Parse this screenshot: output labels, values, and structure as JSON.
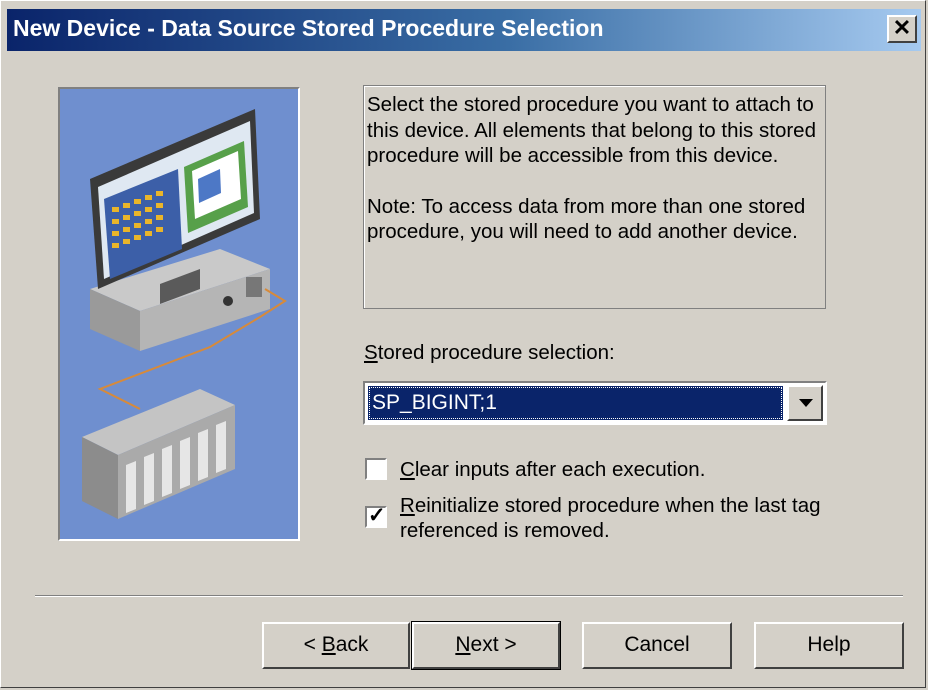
{
  "window": {
    "title": "New Device - Data Source Stored Procedure Selection",
    "close_label": "✕"
  },
  "description": {
    "paragraph1": "Select the stored procedure you want to attach to this device.  All elements that belong to this stored procedure will be accessible from this device.",
    "paragraph2": "Note: To access data from more than one stored procedure, you will need to add another device."
  },
  "selection": {
    "label_prefix": "",
    "label_accel": "S",
    "label_rest": "tored procedure selection:",
    "value": "SP_BIGINT;1"
  },
  "options": {
    "clear_inputs": {
      "accel": "C",
      "rest": "lear inputs after each execution.",
      "checked": false
    },
    "reinitialize": {
      "accel": "R",
      "line1_rest": "einitialize stored procedure when the last tag",
      "line2": "referenced is removed.",
      "checked": true
    }
  },
  "buttons": {
    "back": {
      "prefix": "< ",
      "accel": "B",
      "rest": "ack"
    },
    "next": {
      "accel": "N",
      "rest": "ext >"
    },
    "cancel": "Cancel",
    "help": "Help"
  },
  "icons": {
    "dropdown": "chevron-down-icon",
    "checkmark": "check-icon",
    "illustration": "device-network-illustration"
  }
}
